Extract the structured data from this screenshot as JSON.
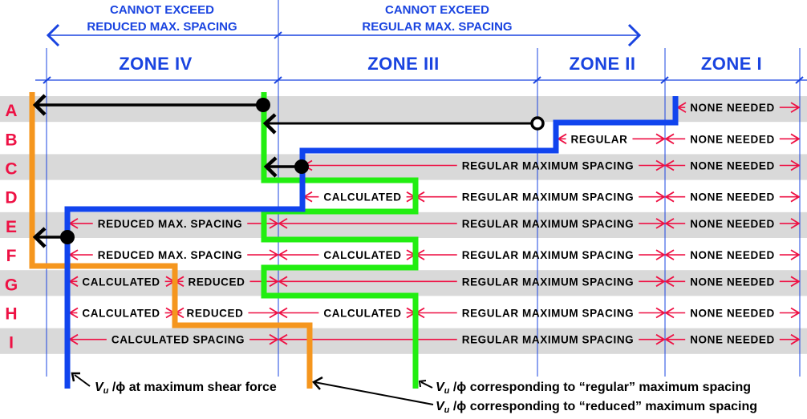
{
  "header": {
    "left_caption": [
      "CANNOT EXCEED",
      "REDUCED MAX. SPACING"
    ],
    "right_caption": [
      "CANNOT EXCEED",
      "REGULAR MAX. SPACING"
    ],
    "zones": [
      "ZONE IV",
      "ZONE III",
      "ZONE II",
      "ZONE I"
    ]
  },
  "rows": [
    {
      "label": "A",
      "segments": [
        {
          "text": "NONE NEEDED",
          "zone": "I"
        }
      ]
    },
    {
      "label": "B",
      "segments": [
        {
          "text": "REGULAR",
          "zone": "II"
        },
        {
          "text": "NONE NEEDED",
          "zone": "I"
        }
      ]
    },
    {
      "label": "C",
      "segments": [
        {
          "text": "REGULAR MAXIMUM SPACING",
          "zone": "III-II"
        },
        {
          "text": "NONE NEEDED",
          "zone": "I"
        }
      ]
    },
    {
      "label": "D",
      "segments": [
        {
          "text": "CALCULATED",
          "zone": "III"
        },
        {
          "text": "REGULAR MAXIMUM SPACING",
          "zone": "III-II"
        },
        {
          "text": "NONE NEEDED",
          "zone": "I"
        }
      ]
    },
    {
      "label": "E",
      "segments": [
        {
          "text": "REDUCED MAX. SPACING",
          "zone": "IV"
        },
        {
          "text": "REGULAR MAXIMUM SPACING",
          "zone": "III-II"
        },
        {
          "text": "NONE NEEDED",
          "zone": "I"
        }
      ]
    },
    {
      "label": "F",
      "segments": [
        {
          "text": "REDUCED MAX. SPACING",
          "zone": "IV"
        },
        {
          "text": "CALCULATED",
          "zone": "III"
        },
        {
          "text": "REGULAR MAXIMUM SPACING",
          "zone": "III-II"
        },
        {
          "text": "NONE NEEDED",
          "zone": "I"
        }
      ]
    },
    {
      "label": "G",
      "segments": [
        {
          "text": "CALCULATED",
          "zone": "IV"
        },
        {
          "text": "REDUCED",
          "zone": "IV"
        },
        {
          "text": "REGULAR MAXIMUM SPACING",
          "zone": "III-II"
        },
        {
          "text": "NONE NEEDED",
          "zone": "I"
        }
      ]
    },
    {
      "label": "H",
      "segments": [
        {
          "text": "CALCULATED",
          "zone": "IV"
        },
        {
          "text": "REDUCED",
          "zone": "IV"
        },
        {
          "text": "CALCULATED",
          "zone": "III"
        },
        {
          "text": "REGULAR MAXIMUM SPACING",
          "zone": "III-II"
        },
        {
          "text": "NONE NEEDED",
          "zone": "I"
        }
      ]
    },
    {
      "label": "I",
      "segments": [
        {
          "text": "CALCULATED SPACING",
          "zone": "IV-III"
        },
        {
          "text": "REGULAR MAXIMUM SPACING",
          "zone": "III-II"
        },
        {
          "text": "NONE NEEDED",
          "zone": "I"
        }
      ]
    }
  ],
  "legend": {
    "symbol_v": "V",
    "symbol_sub": "u",
    "symbol_div": " /ϕ",
    "max_shear": " at maximum shear force",
    "regular": "  corresponding to “regular” maximum spacing",
    "reduced": " corresponding to “reduced” maximum spacing"
  },
  "colors": {
    "blue_line": "#1144ee",
    "green_line": "#22ee11",
    "orange_line": "#f5961e",
    "dimension_red": "#ee1144",
    "header_blue": "#1a44e0",
    "row_shade": "#d9d9d9"
  }
}
